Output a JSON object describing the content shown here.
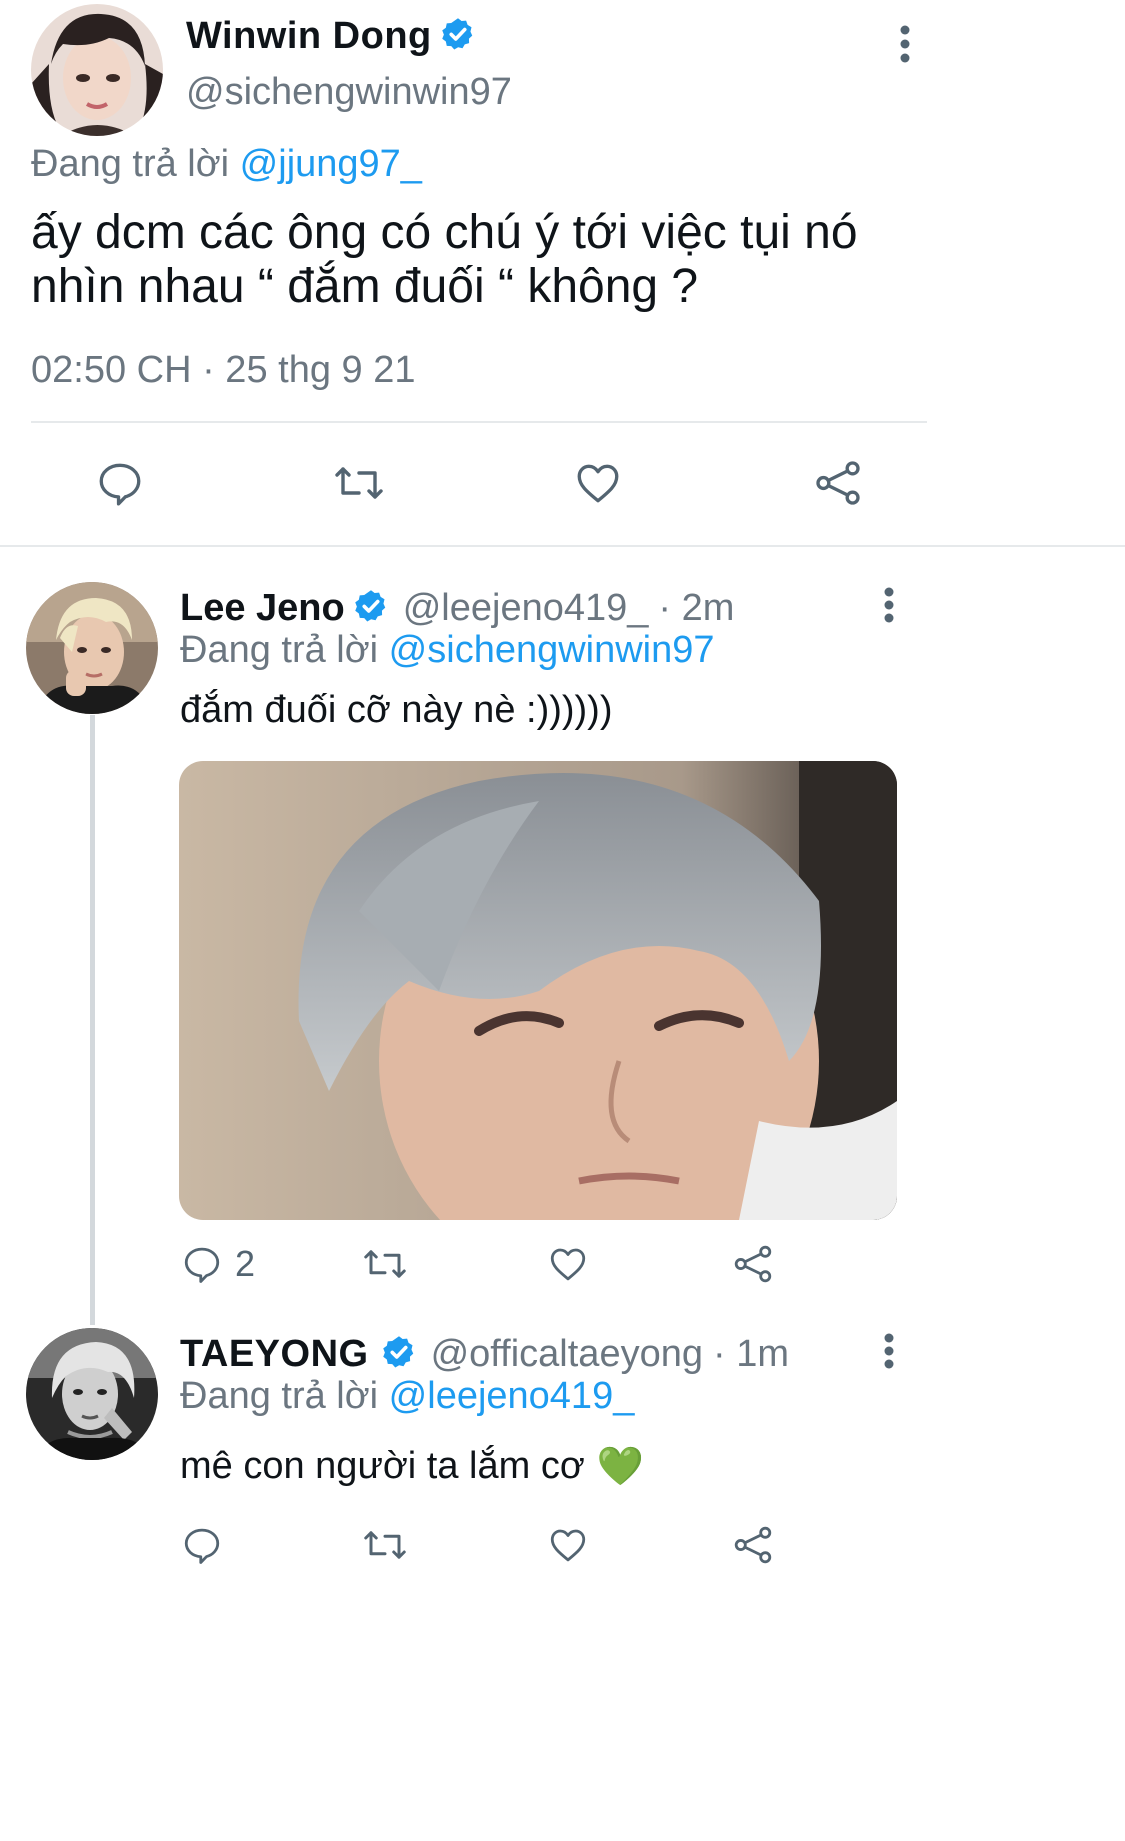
{
  "main_tweet": {
    "display_name": "Winwin Dong",
    "handle": "@sichengwinwin97",
    "replying_prefix": "Đang trả lời",
    "replying_to": "@jjung97_",
    "text_line1": "ấy dcm các ông có chú ý tới việc tụi nó",
    "text_line2": "nhìn nhau “ đắm đuối “ không ?",
    "timestamp": "02:50 CH · 25 thg 9 21"
  },
  "replies": [
    {
      "display_name": "Lee Jeno",
      "handle": "@leejeno419_",
      "time": "· 2m",
      "replying_prefix": "Đang trả lời",
      "replying_to": "@sichengwinwin97",
      "text": "đắm đuối cỡ này nè :))))))",
      "reply_count": "2"
    },
    {
      "display_name": "TAEYONG",
      "handle": "@officaltaeyong",
      "time": "· 1m",
      "replying_prefix": "Đang trả lời",
      "replying_to": "@leejeno419_",
      "text": "mê con người ta lắm cơ",
      "emoji": "💚"
    }
  ],
  "colors": {
    "accent": "#1d9bf0",
    "secondary_text": "#6b7680",
    "divider": "#e6e9eb"
  },
  "icons": [
    "more-vertical-icon",
    "verified-badge-icon",
    "reply-icon",
    "retweet-icon",
    "like-icon",
    "share-icon",
    "green-heart-emoji"
  ]
}
